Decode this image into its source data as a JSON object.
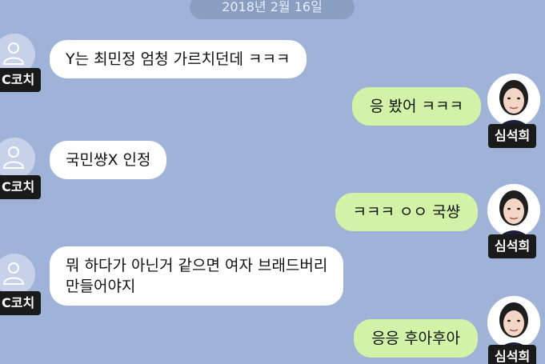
{
  "date_divider": "2018년 2월 16일",
  "colors": {
    "background": "#9fb3d8",
    "incoming_bubble": "#ffffff",
    "outgoing_bubble": "#d2f3a7",
    "name_tag": "#1a1a1a"
  },
  "participants": {
    "coach": {
      "name": "C코치",
      "avatar_icon": "default-person-icon"
    },
    "me": {
      "name": "심석희",
      "avatar_icon": "profile-photo"
    }
  },
  "messages": [
    {
      "sender": "coach",
      "text": "Y는 최민정 엄청 가르치던데 ㅋㅋㅋ"
    },
    {
      "sender": "me",
      "text": "응 봤어 ㅋㅋㅋ"
    },
    {
      "sender": "coach",
      "text": "국민썅X 인정"
    },
    {
      "sender": "me",
      "text": "ㅋㅋㅋ ㅇㅇ 국썅"
    },
    {
      "sender": "coach",
      "lines": [
        "뭐 하다가 아닌거 같으면 여자 브래드버리",
        "만들어야지"
      ]
    },
    {
      "sender": "me",
      "text": "응응 후아후아"
    }
  ]
}
